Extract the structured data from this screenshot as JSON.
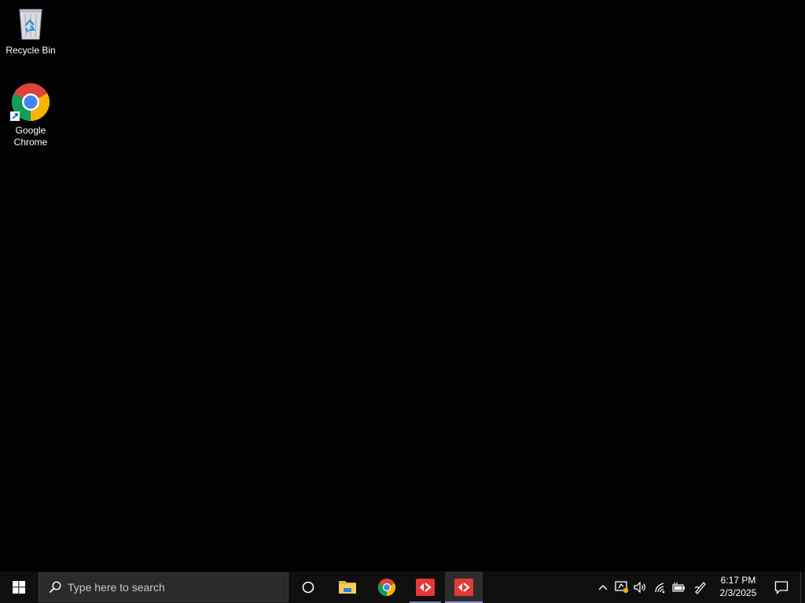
{
  "desktop": {
    "icons": [
      {
        "label": "Recycle Bin",
        "icon": "recycle-bin-icon"
      },
      {
        "label": "Google Chrome",
        "icon": "chrome-icon"
      }
    ]
  },
  "taskbar": {
    "start_icon": "windows-start-icon",
    "search": {
      "placeholder": "Type here to search"
    },
    "pinned": [
      {
        "name": "Cortana",
        "icon": "cortana-circle-icon"
      },
      {
        "name": "File Explorer",
        "icon": "folder-icon"
      },
      {
        "name": "Google Chrome",
        "icon": "chrome-icon"
      },
      {
        "name": "App",
        "icon": "red-app-icon"
      },
      {
        "name": "App (active)",
        "icon": "red-app-icon"
      }
    ],
    "tray": {
      "icons": [
        "chevron-up-icon",
        "security-icon",
        "volume-icon",
        "network-icon",
        "battery-icon",
        "pen-icon"
      ],
      "time": "6:17 PM",
      "date": "2/3/2025"
    },
    "notification_icon": "action-center-icon"
  },
  "colors": {
    "taskbar": "#0f0f0f",
    "search_bg": "#2b2b2b",
    "app_red": "#e53935",
    "active_underline": "#8f8fd0"
  }
}
